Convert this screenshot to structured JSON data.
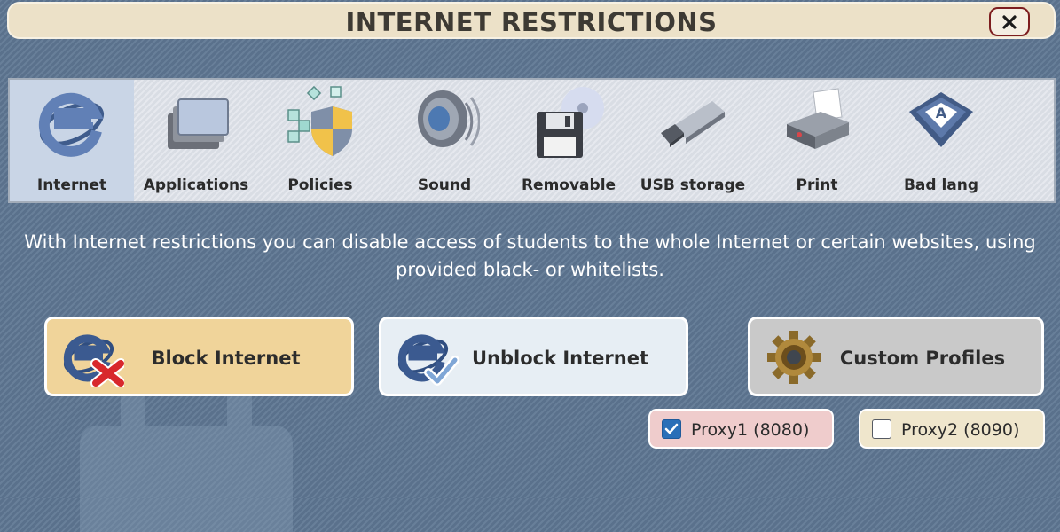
{
  "window": {
    "title": "INTERNET RESTRICTIONS",
    "close_icon": "close-icon"
  },
  "toolbar": {
    "items": [
      {
        "label": "Internet",
        "icon": "internet-explorer-icon",
        "active": true
      },
      {
        "label": "Applications",
        "icon": "applications-windows-icon",
        "active": false
      },
      {
        "label": "Policies",
        "icon": "policies-shield-icon",
        "active": false
      },
      {
        "label": "Sound",
        "icon": "speaker-icon",
        "active": false
      },
      {
        "label": "Removable",
        "icon": "floppy-disc-icon",
        "active": false
      },
      {
        "label": "USB storage",
        "icon": "usb-drive-icon",
        "active": false
      },
      {
        "label": "Print",
        "icon": "printer-icon",
        "active": false
      },
      {
        "label": "Bad lang",
        "icon": "keyboard-key-icon",
        "active": false
      }
    ]
  },
  "description": "With Internet restrictions you can disable access of students to the whole Internet or certain websites, using provided black- or whitelists.",
  "actions": {
    "block": {
      "label": "Block Internet",
      "icon": "block-internet-icon"
    },
    "unblock": {
      "label": "Unblock Internet",
      "icon": "unblock-internet-icon"
    },
    "custom": {
      "label": "Custom Profiles",
      "icon": "gear-icon"
    }
  },
  "proxies": [
    {
      "label": "Proxy1 (8080)",
      "checked": true
    },
    {
      "label": "Proxy2 (8090)",
      "checked": false
    }
  ],
  "colors": {
    "background": "#5f7793",
    "title_bar": "#ece1c8",
    "close_border": "#7d1d1f",
    "block_button": "#f0d49a",
    "unblock_button": "#e7eef4",
    "custom_button": "#c9c9c9",
    "proxy1_bg": "#efcccc",
    "proxy2_bg": "#efe6cc",
    "checkbox_checked": "#2a6fb8"
  }
}
